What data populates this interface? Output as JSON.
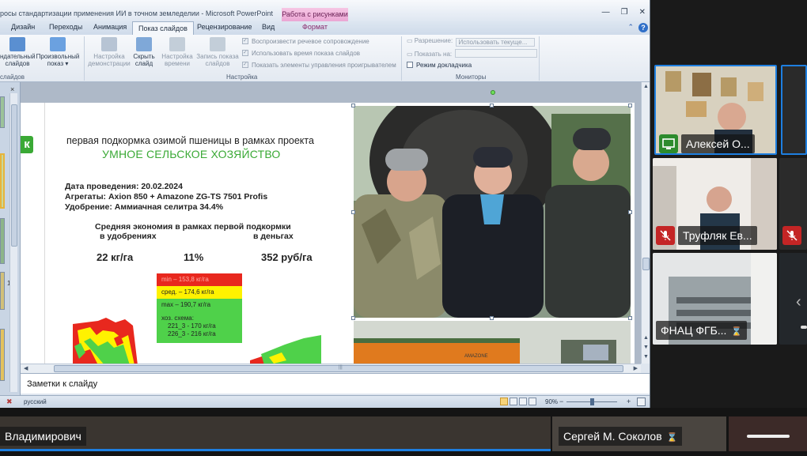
{
  "window": {
    "title": "росы стандартизации применения ИИ в точном земледелии  -  Microsoft PowerPoint",
    "context_tab": "Работа с рисунками",
    "format_tab": "Формат"
  },
  "tabs": [
    "Дизайн",
    "Переходы",
    "Анимация",
    "Показ слайдов",
    "Рецензирование",
    "Вид"
  ],
  "active_tab": "Показ слайдов",
  "ribbon": {
    "btn_custom_top": "ндательный",
    "btn_custom_bottom": "слайдов",
    "btn_custom_arrow": "▾",
    "btn_custom_show_top": "Произвольный",
    "btn_custom_show_bottom": "показ",
    "btn_setup_top": "Настройка",
    "btn_setup_bottom": "демонстрации",
    "btn_hide_top": "Скрыть",
    "btn_hide_bottom": "слайд",
    "btn_timing_top": "Настройка",
    "btn_timing_bottom": "времени",
    "btn_record_top": "Запись показа",
    "btn_record_bottom": "слайдов",
    "chk_narration": "Воспроизвести речевое сопровождение",
    "chk_timings": "Использовать время показа слайдов",
    "chk_media": "Показать элементы управления проигрывателем",
    "res_label": "Разрешение:",
    "res_value": "Использовать текуще...",
    "show_on_label": "Показать на:",
    "presenter_view": "Режим докладчика",
    "group_start": "слайдов",
    "group_setup": "Настройка",
    "group_monitors": "Мониторы"
  },
  "thumb_pane": {
    "close": "×",
    "slide_number": "11"
  },
  "slide": {
    "logo_letter": "к",
    "heading1": "первая подкормка озимой пшеницы в рамках проекта",
    "heading2": "УМНОЕ СЕЛЬСКОЕ ХОЗЯЙСТВО",
    "date_line": "Дата проведения: 20.02.2024",
    "units_line": "Агрегаты: Axion 850 + Amazone ZG-TS 7501 Profis",
    "fert_line": "Удобрение: Аммиачная селитра 34.4%",
    "econ_title": "Средняя экономия в рамках первой подкормки",
    "econ_sub1": "в удобрениях",
    "econ_sub2": "в деньгах",
    "val1": "22 кг/га",
    "val2": "11%",
    "val3": "352 руб/га",
    "legend_min": "min – 153,8 кг/га",
    "legend_mid": "сред. – 174,6 кг/га",
    "legend_max": "max – 190,7 кг/га",
    "legend_scheme_title": "хоз. схема:",
    "legend_scheme_1": "221_3 - 170 кг/га",
    "legend_scheme_2": "226_3 - 216 кг/га",
    "machine_text": "AMAZONE"
  },
  "notes": {
    "placeholder": "Заметки к слайду"
  },
  "statusbar": {
    "language": "русский",
    "zoom": "90%",
    "minus": "−",
    "plus": "+"
  },
  "participants": [
    {
      "name": "Алексей О...",
      "speaking": true
    },
    {
      "name": "Труфляк Ев..."
    },
    {
      "name": "ФНАЦ ФГБ...",
      "hourglass": "⌛"
    }
  ],
  "bottom_participants": [
    {
      "name": "Владимирович"
    },
    {
      "name": "Сергей М. Соколов",
      "hourglass": "⌛"
    }
  ],
  "colors": {
    "green": "#3aa935",
    "speaking_border": "#1e7fe0",
    "mute_red": "#c42525"
  }
}
